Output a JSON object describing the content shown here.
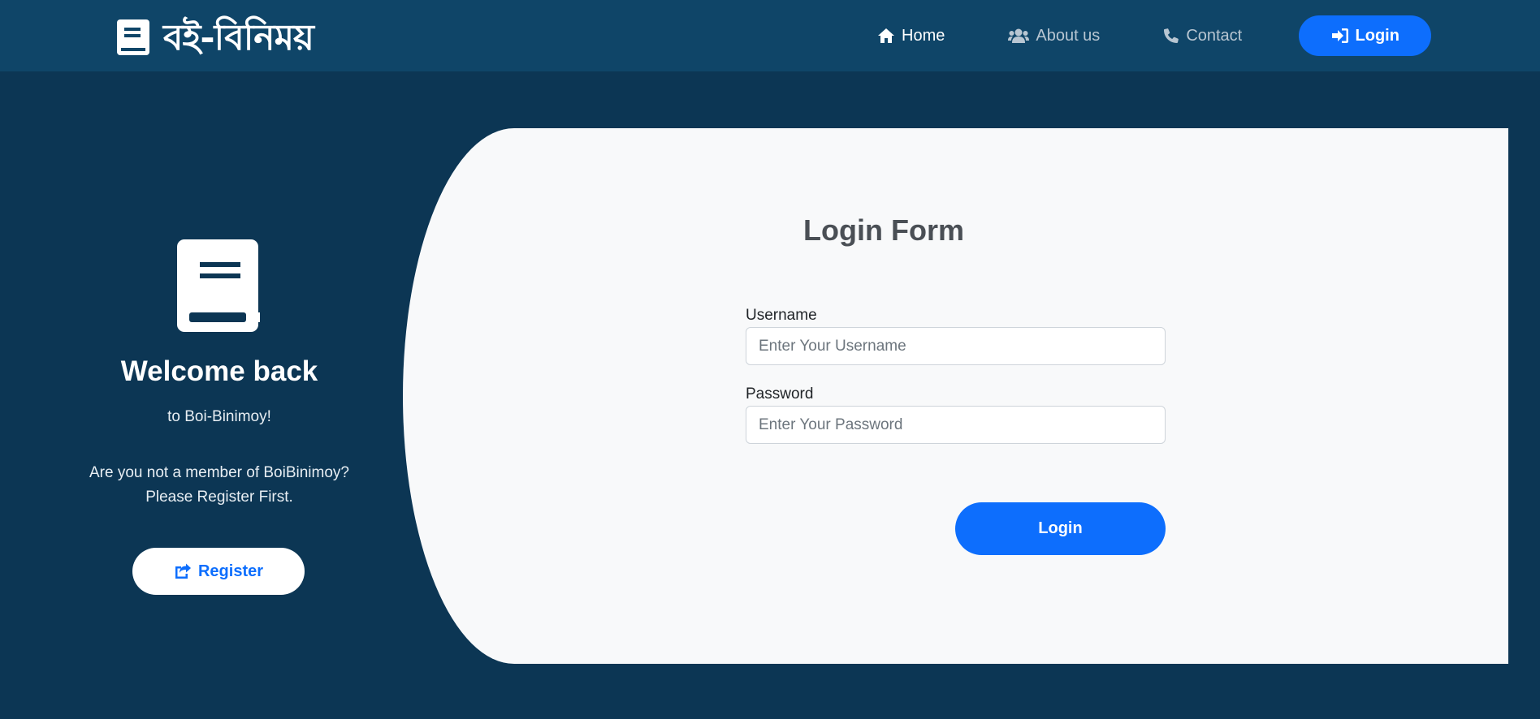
{
  "navbar": {
    "brand_text": "বই-বিনিময়",
    "links": [
      {
        "label": "Home",
        "icon": "home-icon",
        "active": true
      },
      {
        "label": "About us",
        "icon": "users-icon",
        "active": false
      },
      {
        "label": "Contact",
        "icon": "phone-icon",
        "active": false
      }
    ],
    "login_label": "Login"
  },
  "left_panel": {
    "heading": "Welcome back",
    "subheading": "to Boi-Binimoy!",
    "member_line1": "Are you not a member of BoiBinimoy?",
    "member_line2": "Please Register First.",
    "register_label": "Register"
  },
  "form": {
    "title": "Login Form",
    "username_label": "Username",
    "username_placeholder": "Enter Your Username",
    "username_value": "",
    "password_label": "Password",
    "password_placeholder": "Enter Your Password",
    "password_value": "",
    "submit_label": "Login"
  },
  "colors": {
    "page_bg": "#0c3654",
    "navbar_bg": "#0f4568",
    "accent": "#0d6efd",
    "card_bg": "#f8f9fa"
  }
}
